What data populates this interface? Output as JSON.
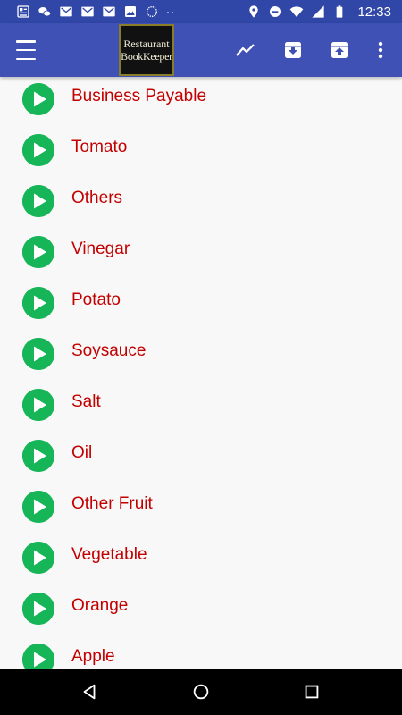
{
  "status_bar": {
    "time": "12:33",
    "dots": "··",
    "left_icons": [
      "news-icon",
      "wechat-icon",
      "gmail-icon",
      "gmail-icon",
      "gmail-icon",
      "image-icon",
      "sync-icon"
    ],
    "right_icons": [
      "location-icon",
      "dnd-icon",
      "wifi-icon",
      "signal-icon",
      "battery-icon"
    ]
  },
  "app_bar": {
    "logo_line1": "Restaurant",
    "logo_line2": "BookKeeper",
    "actions": [
      "menu-icon",
      "trending-icon",
      "archive-down-icon",
      "archive-up-icon",
      "more-vert-icon"
    ],
    "primary_color": "#3f51b5"
  },
  "list": {
    "icon": "play-circle-icon",
    "icon_color": "#16b558",
    "label_color": "#c30000",
    "items": [
      {
        "label": "Business Payable"
      },
      {
        "label": "Tomato"
      },
      {
        "label": "Others"
      },
      {
        "label": "Vinegar"
      },
      {
        "label": "Potato"
      },
      {
        "label": "Soysauce"
      },
      {
        "label": "Salt"
      },
      {
        "label": "Oil"
      },
      {
        "label": "Other Fruit"
      },
      {
        "label": "Vegetable"
      },
      {
        "label": "Orange"
      },
      {
        "label": "Apple"
      }
    ]
  },
  "nav_bar": {
    "buttons": [
      "back-icon",
      "home-icon",
      "recents-icon"
    ]
  }
}
